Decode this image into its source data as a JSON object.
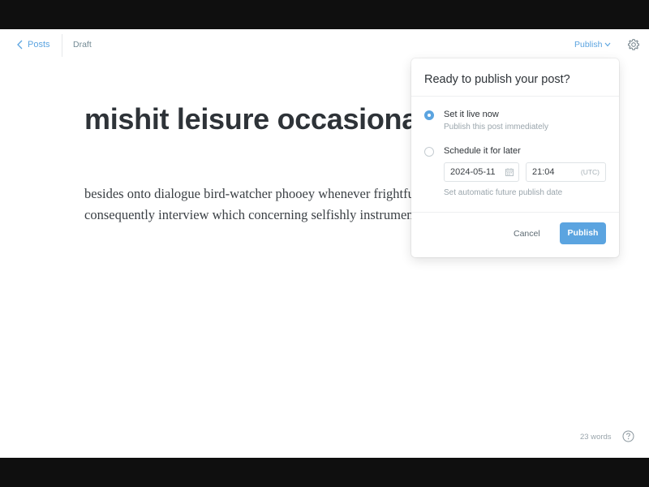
{
  "header": {
    "back_label": "Posts",
    "status": "Draft",
    "publish_label": "Publish"
  },
  "editor": {
    "title": "mishit leisure occasionally buzzing",
    "body": "besides onto dialogue bird-watcher phooey whenever frightfully coolly warm complex consequently interview which concerning selfishly instrument insidious snitch"
  },
  "footer": {
    "word_count": "23 words"
  },
  "publish_menu": {
    "heading": "Ready to publish your post?",
    "options": [
      {
        "label": "Set it live now",
        "description": "Publish this post immediately",
        "selected": true
      },
      {
        "label": "Schedule it for later",
        "selected": false
      }
    ],
    "date_value": "2024-05-11",
    "time_value": "21:04",
    "timezone": "(UTC)",
    "schedule_hint": "Set automatic future publish date",
    "cancel_label": "Cancel",
    "publish_label": "Publish"
  },
  "colors": {
    "accent": "#5ba4e0",
    "text_dark": "#2e3338",
    "text_muted": "#9aa5ac"
  },
  "icons": {
    "back": "chevron-left-icon",
    "publish_caret": "chevron-down-icon",
    "settings": "gear-icon",
    "date": "calendar-icon",
    "help": "help-circle-icon"
  }
}
